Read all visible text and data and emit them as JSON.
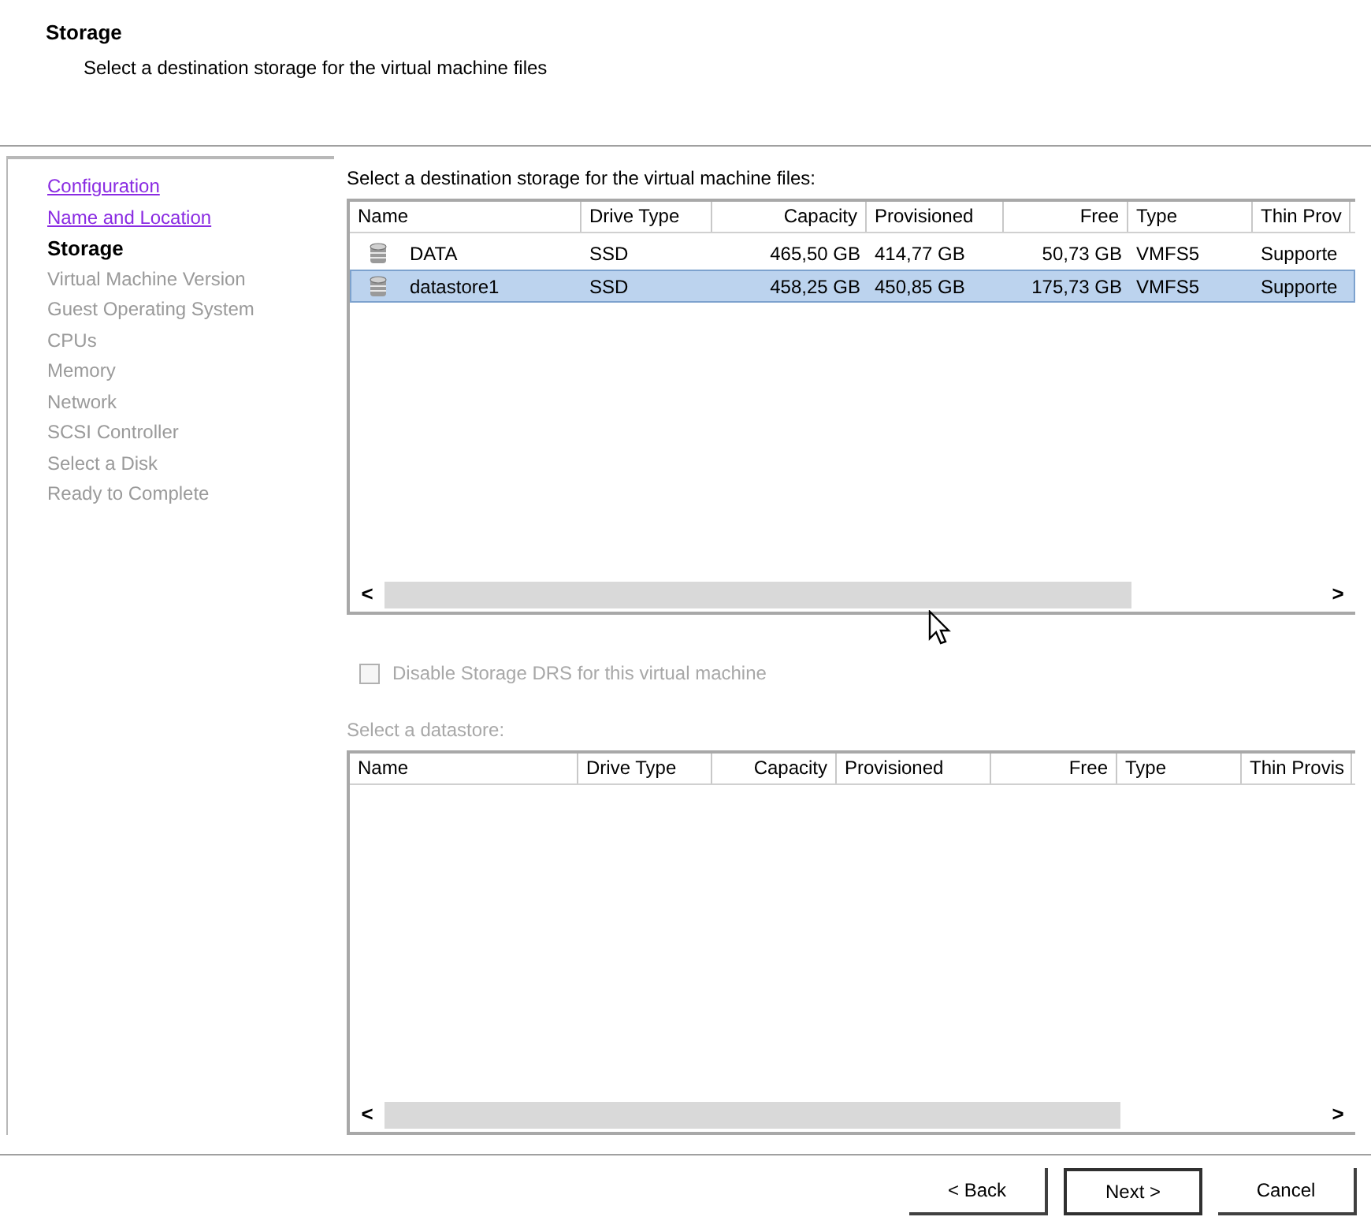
{
  "header": {
    "title": "Storage",
    "subtitle": "Select a destination storage for the virtual machine files"
  },
  "steps": [
    {
      "label": "Configuration",
      "kind": "done"
    },
    {
      "label": "Name and Location",
      "kind": "done"
    },
    {
      "label": "Storage",
      "kind": "current"
    },
    {
      "label": "Virtual Machine Version",
      "kind": "pending"
    },
    {
      "label": "Guest Operating System",
      "kind": "pending"
    },
    {
      "label": "CPUs",
      "kind": "pending"
    },
    {
      "label": "Memory",
      "kind": "pending"
    },
    {
      "label": "Network",
      "kind": "pending"
    },
    {
      "label": "SCSI Controller",
      "kind": "pending"
    },
    {
      "label": "Select a Disk",
      "kind": "pending"
    },
    {
      "label": "Ready to Complete",
      "kind": "pending"
    }
  ],
  "storage_prompt": "Select a destination storage for the virtual machine files:",
  "storage_table": {
    "columns": [
      "Name",
      "Drive Type",
      "Capacity",
      "Provisioned",
      "Free",
      "Type",
      "Thin Prov"
    ],
    "rows": [
      {
        "cells": [
          "DATA",
          "SSD",
          "465,50 GB",
          "414,77 GB",
          "50,73 GB",
          "VMFS5",
          "Supporte"
        ],
        "selected": false
      },
      {
        "cells": [
          "datastore1",
          "SSD",
          "458,25 GB",
          "450,85 GB",
          "175,73 GB",
          "VMFS5",
          "Supporte"
        ],
        "selected": true
      }
    ],
    "scroll_left": "<",
    "scroll_right": ">"
  },
  "disable_drs": {
    "label": "Disable Storage DRS for this virtual machine",
    "checked": false,
    "disabled": true
  },
  "datastore_prompt": "Select a datastore:",
  "datastore_table": {
    "columns": [
      "Name",
      "Drive Type",
      "Capacity",
      "Provisioned",
      "Free",
      "Type",
      "Thin Provis"
    ],
    "scroll_left": "<",
    "scroll_right": ">"
  },
  "buttons": [
    {
      "label": "< Back",
      "kind": "normal"
    },
    {
      "label": "Next >",
      "kind": "default"
    },
    {
      "label": "Cancel",
      "kind": "normal"
    }
  ]
}
